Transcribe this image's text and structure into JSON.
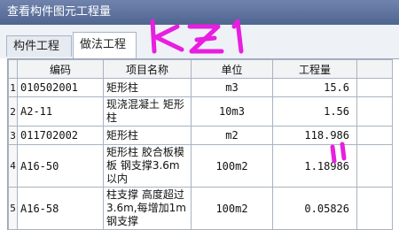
{
  "window": {
    "title": "查看构件图元工程量"
  },
  "tabs": [
    {
      "label": "构件工程量",
      "active": false
    },
    {
      "label": "做法工程量",
      "active": true
    }
  ],
  "table": {
    "columns": [
      "编码",
      "项目名称",
      "单位",
      "工程量"
    ],
    "rows": [
      {
        "index": "1",
        "code": "010502001",
        "name": "矩形柱",
        "unit": "m3",
        "qty": "15.6"
      },
      {
        "index": "2",
        "code": "A2-11",
        "name": "现浇混凝土 矩形柱",
        "unit": "10m3",
        "qty": "1.56"
      },
      {
        "index": "3",
        "code": "011702002",
        "name": "矩形柱",
        "unit": "m2",
        "qty": "118.986"
      },
      {
        "index": "4",
        "code": "A16-50",
        "name": "矩形柱 胶合板模板 钢支撑3.6m以内",
        "unit": "100m2",
        "qty": "1.18986"
      },
      {
        "index": "5",
        "code": "A16-58",
        "name": "柱支撑 高度超过3.6m,每增加1m钢支撑",
        "unit": "100m2",
        "qty": "0.05826"
      }
    ]
  },
  "annotations": {
    "handwriting": "KZ1",
    "color": "#e81ee0"
  },
  "colors": {
    "titlebar": "#5a6f9c",
    "grid_border": "#a9b3c1"
  }
}
